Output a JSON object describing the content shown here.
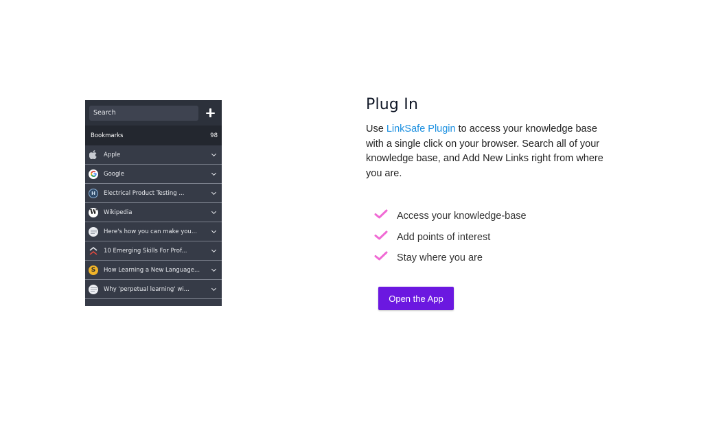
{
  "plugin": {
    "search_placeholder": "Search",
    "bookmarks_label": "Bookmarks",
    "bookmarks_count": "98",
    "items": [
      {
        "title": "Apple",
        "icon": "apple-icon"
      },
      {
        "title": "Google",
        "icon": "google-icon"
      },
      {
        "title": "Electrical Product Testing ...",
        "icon": "testing-site-icon"
      },
      {
        "title": "Wikipedia",
        "icon": "wikipedia-icon"
      },
      {
        "title": "Here's how you can make you...",
        "icon": "article-icon"
      },
      {
        "title": "10 Emerging Skills For Prof...",
        "icon": "skills-site-icon"
      },
      {
        "title": "How Learning a New Language...",
        "icon": "language-site-icon"
      },
      {
        "title": "Why 'perpetual learning' wi...",
        "icon": "article-icon"
      }
    ]
  },
  "section": {
    "title": "Plug In",
    "desc_before": "Use ",
    "desc_link": "LinkSafe Plugin",
    "desc_after": " to access your knowledge base with a single click on your browser. Search all of your knowledge base, and Add New Links right from where you are.",
    "features": [
      "Access your knowledge-base",
      "Add points of interest",
      "Stay where you are"
    ],
    "button_label": "Open the App"
  },
  "colors": {
    "accent": "#6b18e0",
    "link": "#1a8fe0",
    "check": "#f06ad4",
    "panel_bg": "#363b47"
  }
}
